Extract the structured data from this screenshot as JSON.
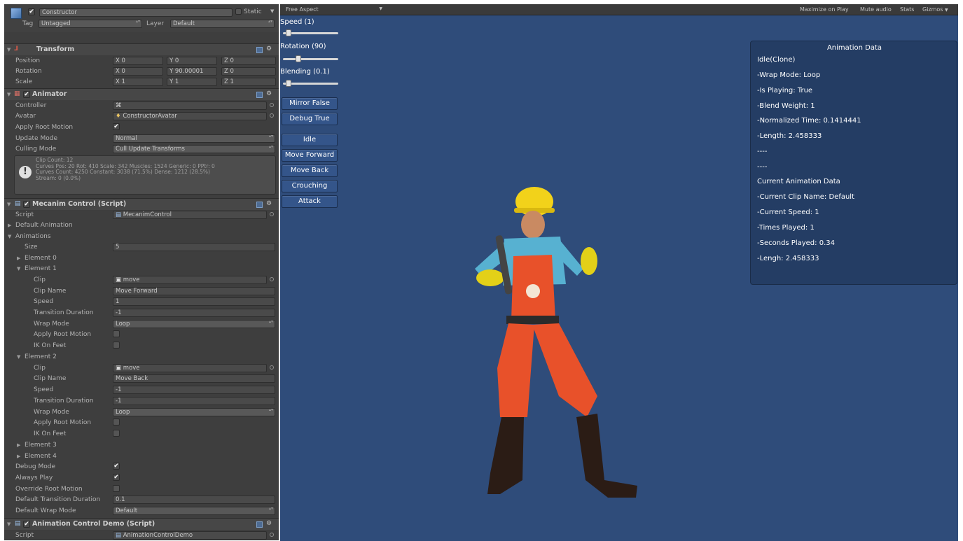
{
  "inspector": {
    "object_name": "Constructor",
    "static_label": "Static",
    "tag_label": "Tag",
    "tag_value": "Untagged",
    "layer_label": "Layer",
    "layer_value": "Default",
    "transform": {
      "title": "Transform",
      "position_label": "Position",
      "position": {
        "x": "X 0",
        "y": "Y 0",
        "z": "Z 0"
      },
      "rotation_label": "Rotation",
      "rotation": {
        "x": "X 0",
        "y": "Y 90.00001",
        "z": "Z 0"
      },
      "scale_label": "Scale",
      "scale": {
        "x": "X 1",
        "y": "Y 1",
        "z": "Z 1"
      }
    },
    "animator": {
      "title": "Animator",
      "controller_label": "Controller",
      "controller_value": "",
      "avatar_label": "Avatar",
      "avatar_value": "ConstructorAvatar",
      "apply_root_motion_label": "Apply Root Motion",
      "update_mode_label": "Update Mode",
      "update_mode_value": "Normal",
      "culling_mode_label": "Culling Mode",
      "culling_mode_value": "Cull Update Transforms",
      "info": "Clip Count: 12\nCurves Pos: 20 Rot: 410 Scale: 342 Muscles: 1524 Generic: 0 PPtr: 0\nCurves Count: 4250 Constant: 3038 (71.5%) Dense: 1212 (28.5%)\nStream: 0 (0.0%)"
    },
    "mecanim": {
      "title": "Mecanim Control (Script)",
      "script_label": "Script",
      "script_value": "MecanimControl",
      "default_animation_label": "Default Animation",
      "animations_label": "Animations",
      "size_label": "Size",
      "size_value": "5",
      "element0_label": "Element 0",
      "element1": {
        "label": "Element 1",
        "clip_label": "Clip",
        "clip_value": "move",
        "clip_name_label": "Clip Name",
        "clip_name_value": "Move Forward",
        "speed_label": "Speed",
        "speed_value": "1",
        "transition_label": "Transition Duration",
        "transition_value": "-1",
        "wrap_label": "Wrap Mode",
        "wrap_value": "Loop",
        "root_motion_label": "Apply Root Motion",
        "ik_label": "IK On Feet"
      },
      "element2": {
        "label": "Element 2",
        "clip_label": "Clip",
        "clip_value": "move",
        "clip_name_label": "Clip Name",
        "clip_name_value": "Move Back",
        "speed_label": "Speed",
        "speed_value": "-1",
        "transition_label": "Transition Duration",
        "transition_value": "-1",
        "wrap_label": "Wrap Mode",
        "wrap_value": "Loop",
        "root_motion_label": "Apply Root Motion",
        "ik_label": "IK On Feet"
      },
      "element3_label": "Element 3",
      "element4_label": "Element 4",
      "debug_mode_label": "Debug Mode",
      "always_play_label": "Always Play",
      "override_root_label": "Override Root Motion",
      "default_transition_label": "Default Transition Duration",
      "default_transition_value": "0.1",
      "default_wrap_label": "Default Wrap Mode",
      "default_wrap_value": "Default"
    },
    "demo": {
      "title": "Animation Control Demo (Script)",
      "script_label": "Script",
      "script_value": "AnimationControlDemo"
    }
  },
  "game": {
    "toolbar": {
      "aspect": "Free Aspect",
      "maximize": "Maximize on Play",
      "mute": "Mute audio",
      "stats": "Stats",
      "gizmos": "Gizmos"
    },
    "speed_label": "Speed (1)",
    "speed_fraction": 0.05,
    "rotation_label": "Rotation (90)",
    "rotation_fraction": 0.25,
    "blending_label": "Blending (0.1)",
    "blending_fraction": 0.05,
    "buttons": {
      "mirror": "Mirror False",
      "debug": "Debug True",
      "idle": "Idle",
      "move_forward": "Move Forward",
      "move_back": "Move Back",
      "crouching": "Crouching",
      "attack": "Attack"
    },
    "panel": {
      "title": "Animation Data",
      "lines": [
        "Idle(Clone)",
        "-Wrap Mode: Loop",
        "-Is Playing: True",
        "-Blend Weight: 1",
        "-Normalized Time: 0.1414441",
        "-Length: 2.458333",
        "----",
        "----",
        "Current Animation Data",
        "-Current Clip Name: Default",
        "-Current Speed: 1",
        "-Times Played: 1",
        "-Seconds Played: 0.34",
        "-Lengh: 2.458333"
      ]
    }
  },
  "colors": {
    "inspector_bg": "#3e3e3e",
    "game_bg": "#2f4c7a",
    "panel_bg": "#243d64"
  }
}
